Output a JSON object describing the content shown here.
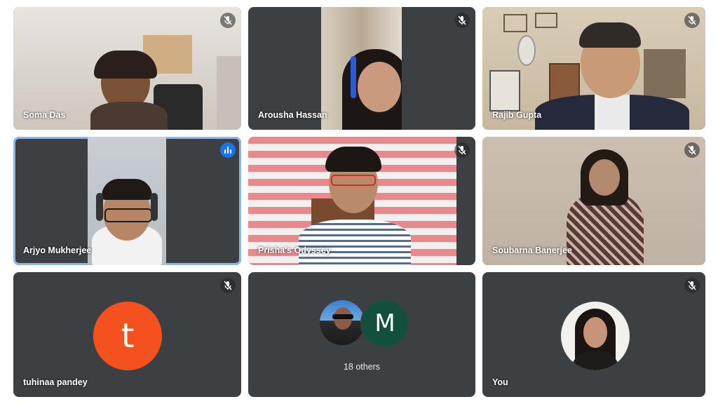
{
  "participants": [
    {
      "name": "Soma Das",
      "muted": true
    },
    {
      "name": "Arousha Hassan",
      "muted": true
    },
    {
      "name": "Rajib Gupta",
      "muted": true
    },
    {
      "name": "Arjyo Mukherjee",
      "speaking": true
    },
    {
      "name": "Prisha's Odyssey",
      "muted": true
    },
    {
      "name": "Soubarna Banerjee",
      "muted": true
    },
    {
      "name": "tuhinaa pandey",
      "avatar_letter": "t",
      "avatar_color": "#f4511e",
      "muted": true
    },
    {
      "others_label": "18 others",
      "avatar_letter": "M",
      "avatar_color": "#12503d",
      "muted": false
    },
    {
      "name": "You",
      "muted": true
    }
  ],
  "colors": {
    "tile_bg": "#3c4043",
    "active_border": "#8ab4f8",
    "speaking_badge": "#1a73e8"
  }
}
